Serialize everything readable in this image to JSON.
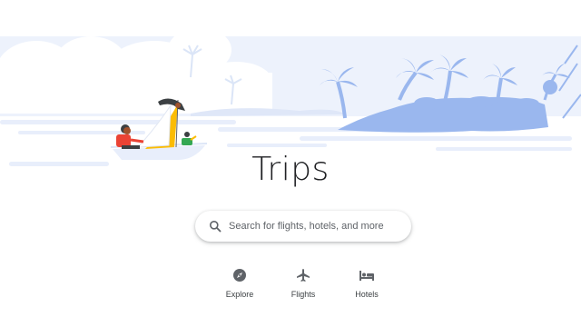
{
  "page": {
    "title": "Trips"
  },
  "search": {
    "placeholder": "Search for flights, hotels, and more",
    "value": "",
    "icon": "search-icon"
  },
  "nav": {
    "items": [
      {
        "label": "Explore",
        "icon": "compass-icon"
      },
      {
        "label": "Flights",
        "icon": "airplane-icon"
      },
      {
        "label": "Hotels",
        "icon": "bed-icon"
      }
    ]
  },
  "colors": {
    "banner_light": "#e8eefb",
    "banner_mid": "#c6d6f6",
    "island": "#9ab7ee",
    "sail": "#fbbc04",
    "text": "#202124"
  }
}
